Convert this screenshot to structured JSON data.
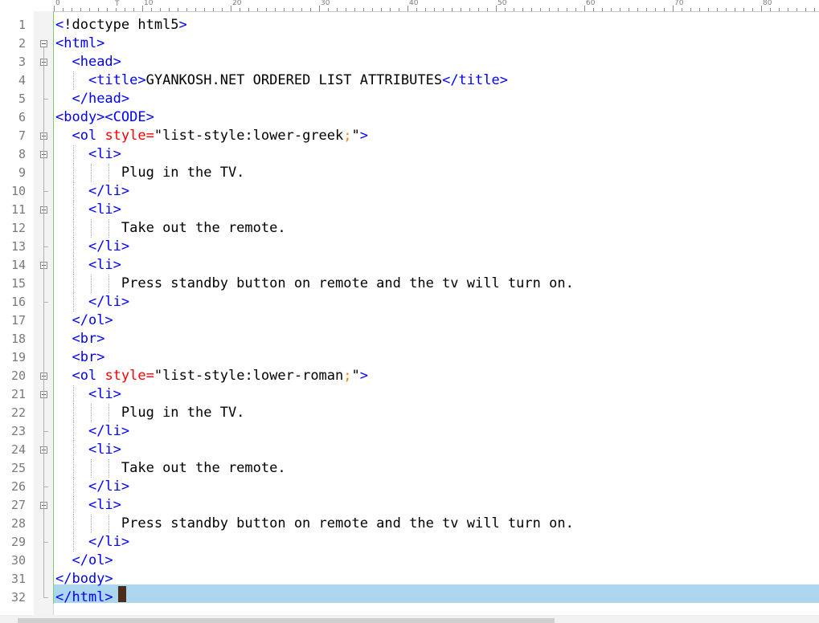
{
  "ruler": {
    "labels": [
      "0",
      "10",
      "20",
      "30",
      "40",
      "50",
      "60",
      "70",
      "80"
    ],
    "caret_marker": "T"
  },
  "lines": [
    {
      "n": "1",
      "indent": 0,
      "segs": [
        [
          "t",
          "<"
        ],
        [
          "v",
          "!doctype html5"
        ],
        [
          "t",
          ">"
        ]
      ]
    },
    {
      "n": "2",
      "indent": 0,
      "segs": [
        [
          "t",
          "<html>"
        ]
      ]
    },
    {
      "n": "3",
      "indent": 2,
      "segs": [
        [
          "t",
          "<head>"
        ]
      ]
    },
    {
      "n": "4",
      "indent": 4,
      "segs": [
        [
          "t",
          "<title>"
        ],
        [
          "v",
          "GYANKOSH.NET ORDERED LIST ATTRIBUTES"
        ],
        [
          "t",
          "</title>"
        ]
      ]
    },
    {
      "n": "5",
      "indent": 2,
      "segs": [
        [
          "t",
          "</head>"
        ]
      ]
    },
    {
      "n": "6",
      "indent": 0,
      "segs": [
        [
          "t",
          "<body><CODE>"
        ]
      ]
    },
    {
      "n": "7",
      "indent": 2,
      "segs": [
        [
          "t",
          "<ol "
        ],
        [
          "a",
          "style="
        ],
        [
          "v",
          "\"list-style:lower-greek"
        ],
        [
          "s",
          ";"
        ],
        [
          "v",
          "\""
        ],
        [
          "t",
          ">"
        ]
      ]
    },
    {
      "n": "8",
      "indent": 4,
      "segs": [
        [
          "t",
          "<li>"
        ]
      ]
    },
    {
      "n": "9",
      "indent": 8,
      "segs": [
        [
          "v",
          "Plug in the TV."
        ]
      ]
    },
    {
      "n": "10",
      "indent": 4,
      "segs": [
        [
          "t",
          "</li>"
        ]
      ]
    },
    {
      "n": "11",
      "indent": 4,
      "segs": [
        [
          "t",
          "<li>"
        ]
      ]
    },
    {
      "n": "12",
      "indent": 8,
      "segs": [
        [
          "v",
          "Take out the remote."
        ]
      ]
    },
    {
      "n": "13",
      "indent": 4,
      "segs": [
        [
          "t",
          "</li>"
        ]
      ]
    },
    {
      "n": "14",
      "indent": 4,
      "segs": [
        [
          "t",
          "<li>"
        ]
      ]
    },
    {
      "n": "15",
      "indent": 8,
      "segs": [
        [
          "v",
          "Press standby button on remote and the tv will turn on."
        ]
      ]
    },
    {
      "n": "16",
      "indent": 4,
      "segs": [
        [
          "t",
          "</li>"
        ]
      ]
    },
    {
      "n": "17",
      "indent": 2,
      "segs": [
        [
          "t",
          "</ol>"
        ]
      ]
    },
    {
      "n": "18",
      "indent": 2,
      "segs": [
        [
          "t",
          "<br>"
        ]
      ]
    },
    {
      "n": "19",
      "indent": 2,
      "segs": [
        [
          "t",
          "<br>"
        ]
      ]
    },
    {
      "n": "20",
      "indent": 2,
      "segs": [
        [
          "t",
          "<ol "
        ],
        [
          "a",
          "style="
        ],
        [
          "v",
          "\"list-style:lower-roman"
        ],
        [
          "s",
          ";"
        ],
        [
          "v",
          "\""
        ],
        [
          "t",
          ">"
        ]
      ]
    },
    {
      "n": "21",
      "indent": 4,
      "segs": [
        [
          "t",
          "<li>"
        ]
      ]
    },
    {
      "n": "22",
      "indent": 8,
      "segs": [
        [
          "v",
          "Plug in the TV."
        ]
      ]
    },
    {
      "n": "23",
      "indent": 4,
      "segs": [
        [
          "t",
          "</li>"
        ]
      ]
    },
    {
      "n": "24",
      "indent": 4,
      "segs": [
        [
          "t",
          "<li>"
        ]
      ]
    },
    {
      "n": "25",
      "indent": 8,
      "segs": [
        [
          "v",
          "Take out the remote."
        ]
      ]
    },
    {
      "n": "26",
      "indent": 4,
      "segs": [
        [
          "t",
          "</li>"
        ]
      ]
    },
    {
      "n": "27",
      "indent": 4,
      "segs": [
        [
          "t",
          "<li>"
        ]
      ]
    },
    {
      "n": "28",
      "indent": 8,
      "segs": [
        [
          "v",
          "Press standby button on remote and the tv will turn on."
        ]
      ]
    },
    {
      "n": "29",
      "indent": 4,
      "segs": [
        [
          "t",
          "</li>"
        ]
      ]
    },
    {
      "n": "30",
      "indent": 2,
      "segs": [
        [
          "t",
          "</ol>"
        ]
      ]
    },
    {
      "n": "31",
      "indent": 0,
      "segs": [
        [
          "t",
          "</body>"
        ]
      ]
    },
    {
      "n": "32",
      "indent": 0,
      "segs": [
        [
          "t",
          "</html>"
        ]
      ]
    }
  ],
  "fold_open_lines": [
    "2",
    "3",
    "7",
    "8",
    "11",
    "14",
    "20",
    "21",
    "24",
    "27"
  ],
  "fold_close_lines": [
    "5",
    "10",
    "13",
    "16",
    "23",
    "26",
    "29",
    "32"
  ],
  "current_line": "32",
  "colors": {
    "tag": "#0000ff",
    "attribute": "#ff0000",
    "text": "#000000",
    "semicolon": "#ff8000",
    "line_number": "#7a7a7a",
    "current_line_highlight": "#acd6ee",
    "fold_bar": "#7ccf6a",
    "caret": "#4a2d1a"
  }
}
